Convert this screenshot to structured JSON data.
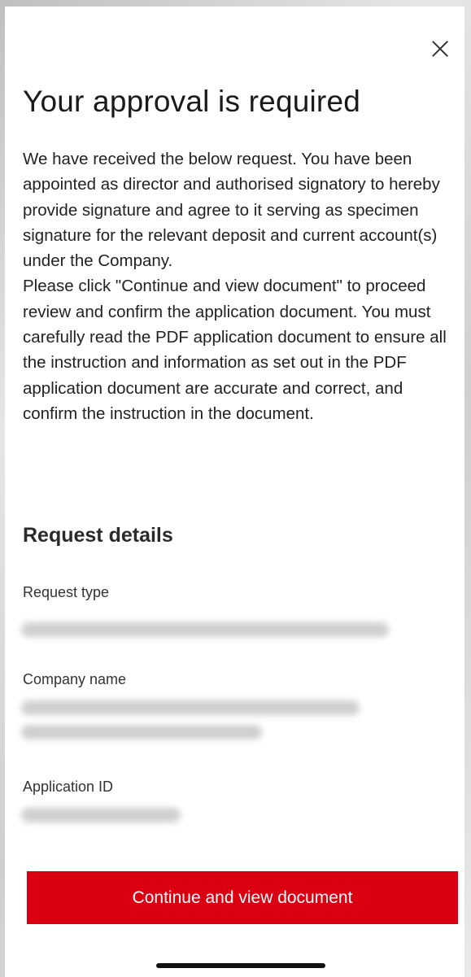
{
  "header": {
    "close_icon": "close-icon"
  },
  "title": "Your approval is required",
  "intro": {
    "paragraph_1": "We have received the below request. You have been appointed as director and authorised signatory to hereby provide signature and agree to it serving as specimen signature for the relevant deposit and current account(s) under the Company.",
    "paragraph_2": "Please click \"Continue and view document\" to proceed review and confirm the application document. You must carefully read the PDF application document to ensure all the instruction and information as set out in the PDF application document are accurate and correct, and confirm the instruction in the document."
  },
  "details": {
    "heading": "Request details",
    "request_type_label": "Request type",
    "company_name_label": "Company name",
    "application_id_label": "Application ID"
  },
  "actions": {
    "continue_label": "Continue and view document"
  },
  "colors": {
    "accent": "#db0011"
  }
}
